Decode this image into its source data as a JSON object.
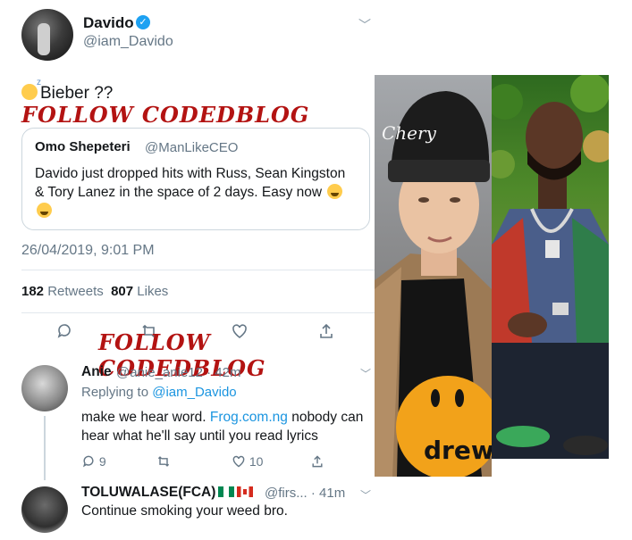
{
  "tweet": {
    "author_name": "Davido",
    "author_handle": "@iam_Davido",
    "text": "Bieber ??",
    "text_emoji": "sleepy-face-emoji",
    "watermark": "FOLLOW CODEDBLOG",
    "quoted": {
      "name": "Omo Shepeteri",
      "handle": "@ManLikeCEO",
      "text": "Davido just dropped hits with Russ, Sean Kingston & Tory Lanez in the space of  2 days. Easy now",
      "emoji": "laughing-emoji"
    },
    "timestamp": "26/04/2019, 9:01 PM",
    "retweets_count": "182",
    "retweets_label": "Retweets",
    "likes_count": "807",
    "likes_label": "Likes"
  },
  "replies": [
    {
      "name": "Anie",
      "handle": "@anie_anie12 · 42m",
      "replying_prefix": "Replying to ",
      "replying_to": "@iam_Davido",
      "text_before_link": "make we hear word. ",
      "link": "Frog.com.ng",
      "text_after_link": " nobody can hear what he'll say until you read lyrics",
      "reply_count": "9",
      "like_count": "10"
    },
    {
      "name": "TOLUWALASE(FCA)",
      "flags": [
        "nigeria-flag",
        "canada-flag"
      ],
      "handle": "@firs... · 41m",
      "text": "Continue smoking your weed bro."
    }
  ],
  "photos": {
    "left": {
      "hat_text": "Chery",
      "shirt_text": "drew"
    },
    "right": {}
  },
  "colors": {
    "accent": "#1da1f2",
    "link": "#1b95e0",
    "watermark": "#b31312",
    "muted": "#657786"
  }
}
